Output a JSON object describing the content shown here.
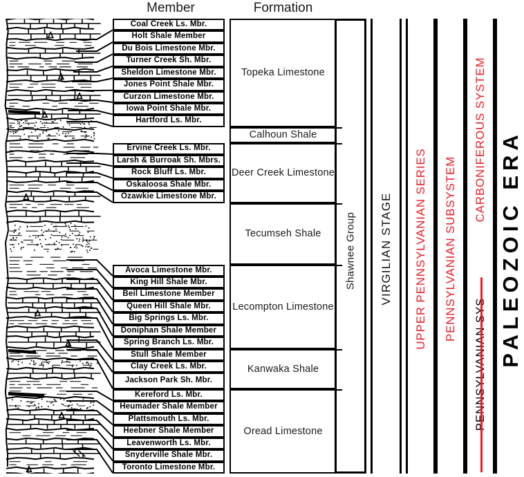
{
  "headers": {
    "member": "Member",
    "formation": "Formation"
  },
  "colors": {
    "red": "#ED1C24",
    "black": "#000000",
    "background": "#FFFFFF"
  },
  "members": [
    {
      "label": "Coal Creek Ls. Mbr.",
      "lith": "limestone"
    },
    {
      "label": "Holt Shale Member",
      "lith": "shale"
    },
    {
      "label": "Du Bois Limestone Mbr.",
      "lith": "limestone"
    },
    {
      "label": "Turner Creek Sh. Mbr.",
      "lith": "shale"
    },
    {
      "label": "Sheldon Limestone Mbr.",
      "lith": "limestone"
    },
    {
      "label": "Jones Point Shale Mbr.",
      "lith": "shale"
    },
    {
      "label": "Curzon Limestone Mbr.",
      "lith": "limestone"
    },
    {
      "label": "Iowa Point Shale Mbr.",
      "lith": "shale"
    },
    {
      "label": "Hartford Ls. Mbr.",
      "lith": "limestone"
    },
    {
      "label": "",
      "lith": "shale"
    },
    {
      "label": "Ervine Creek Ls. Mbr.",
      "lith": "limestone"
    },
    {
      "label": "Larsh & Burroak Sh. Mbrs.",
      "lith": "shale"
    },
    {
      "label": "Rock Bluff Ls. Mbr.",
      "lith": "limestone"
    },
    {
      "label": "Oskaloosa Shale Mbr.",
      "lith": "shale"
    },
    {
      "label": "Ozawkie Limestone Mbr.",
      "lith": "limestone"
    },
    {
      "label": "",
      "lith": "shale"
    },
    {
      "label": "Avoca Limestone Mbr.",
      "lith": "limestone"
    },
    {
      "label": "King Hill Shale Mbr.",
      "lith": "shale"
    },
    {
      "label": "Beil Limestone Member",
      "lith": "limestone"
    },
    {
      "label": "Queen Hill Shale Mbr.",
      "lith": "shale"
    },
    {
      "label": "Big Springs Ls. Mbr.",
      "lith": "limestone"
    },
    {
      "label": "Doniphan Shale Member",
      "lith": "shale"
    },
    {
      "label": "Spring Branch Ls. Mbr.",
      "lith": "limestone"
    },
    {
      "label": "Stull Shale Member",
      "lith": "shale"
    },
    {
      "label": "Clay Creek Ls. Mbr.",
      "lith": "limestone"
    },
    {
      "label": "Jackson Park Sh. Mbr.",
      "lith": "shale"
    },
    {
      "label": "Kereford Ls. Mbr.",
      "lith": "limestone"
    },
    {
      "label": "Heumader Shale Member",
      "lith": "shale"
    },
    {
      "label": "Plattsmouth Ls. Mbr.",
      "lith": "limestone"
    },
    {
      "label": "Heebner Shale Member",
      "lith": "shale"
    },
    {
      "label": "Leavenworth Ls. Mbr.",
      "lith": "limestone"
    },
    {
      "label": "Snyderville Shale Mbr.",
      "lith": "shale"
    },
    {
      "label": "Toronto Limestone Mbr.",
      "lith": "limestone"
    }
  ],
  "formations": [
    {
      "label": "Topeka Limestone",
      "members": 9
    },
    {
      "label": "Calhoun Shale",
      "members": 1
    },
    {
      "label": "Deer Creek Limestone",
      "members": 5
    },
    {
      "label": "Tecumseh Shale",
      "members": 1
    },
    {
      "label": "Lecompton Limestone",
      "members": 7
    },
    {
      "label": "Kanwaka Shale",
      "members": 3
    },
    {
      "label": "Oread Limestone",
      "members": 7
    }
  ],
  "group": {
    "label": "Shawnee Group"
  },
  "stage": {
    "label": "VIRGILIAN STAGE",
    "color": "#111111"
  },
  "series": {
    "label": "UPPER PENNSYLVANIAN SERIES",
    "color": "#ED1C24"
  },
  "subsystem": {
    "label": "PENNSYLVANIAN SUBSYSTEM",
    "color": "#ED1C24"
  },
  "system": {
    "old_label": "PENNSYLVANIAN SYS",
    "old_color": "#000000",
    "new_label": "CARBONIFEROUS SYSTEM",
    "new_color": "#ED1C24",
    "strikethrough_color": "#ED1C24"
  },
  "era": {
    "label": "PALEOZOIC ERA",
    "color": "#000000"
  }
}
